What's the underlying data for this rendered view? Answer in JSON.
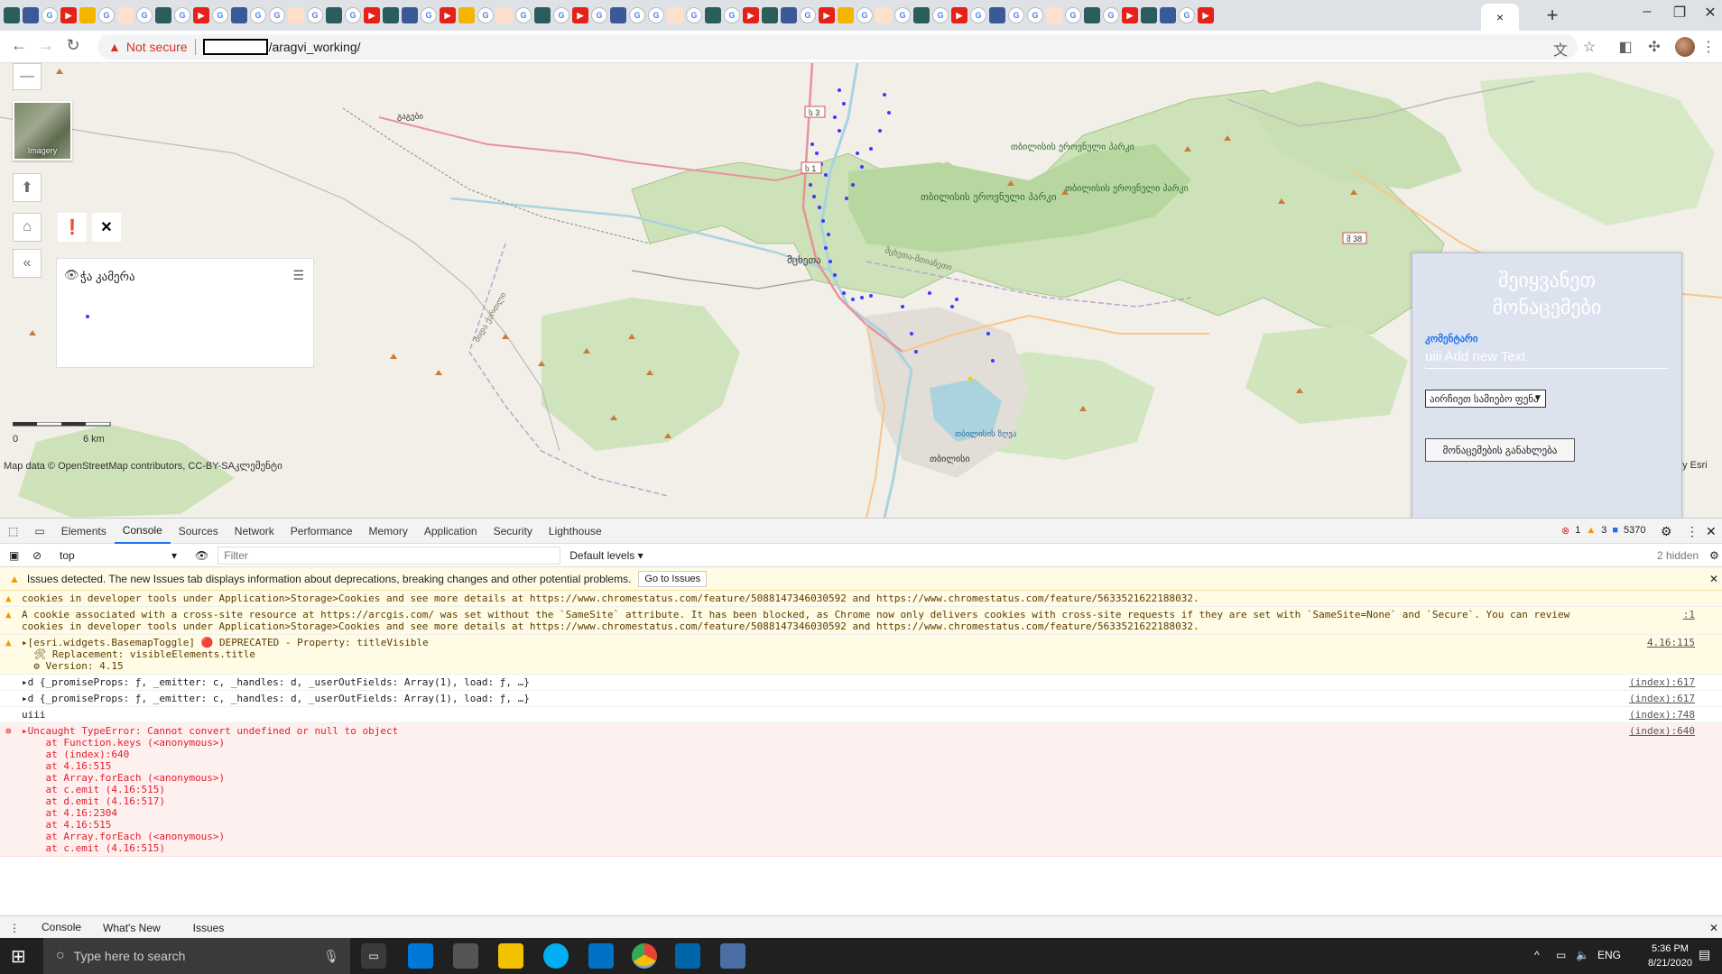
{
  "browser": {
    "tab_count_favicons": 64,
    "active_tab_close": "×",
    "new_tab": "+",
    "window_controls": [
      "–",
      "❐",
      "✕"
    ]
  },
  "address_bar": {
    "security_label": "Not secure",
    "url_path": "/aragvi_working/"
  },
  "map": {
    "basemap_label": "Imagery",
    "zoom_out": "—",
    "legend_title": "ჭა კამერა",
    "scale_zero": "0",
    "scale_km": "6 km",
    "attribution": "Map data © OpenStreetMap contributors, CC-BY-SAკლემენტი",
    "attribution_esri": "by Esri",
    "places": [
      {
        "name": "მცხეთა",
        "kind": "town"
      },
      {
        "name": "თბილისის ეროვნული პარკი",
        "kind": "park"
      },
      {
        "name": "თბილისის ეროვნული პარკი",
        "kind": "park"
      },
      {
        "name": "თბილისის ეროვნული პარკი",
        "kind": "park"
      },
      {
        "name": "თბილისის ზღვა",
        "kind": "water"
      },
      {
        "name": "თბილისი",
        "kind": "city"
      },
      {
        "name": "მცხეთა-მთიანეთი",
        "kind": "region"
      },
      {
        "name": "შიდა ქართლი",
        "kind": "region"
      },
      {
        "name": "გაგები",
        "kind": "town"
      }
    ],
    "road_shields": [
      "ს 3",
      "ს 1",
      "შ 38"
    ]
  },
  "form": {
    "title_line1": "შეიყვანეთ",
    "title_line2": "მონაცემები",
    "field_label": "კომენტარი",
    "field_value": "uiii Add new Text",
    "select_value": "აირჩიეთ სამიებო ფენა",
    "submit_label": "მონაცემების განახლება"
  },
  "devtools": {
    "tabs": [
      "Elements",
      "Console",
      "Sources",
      "Network",
      "Performance",
      "Memory",
      "Application",
      "Security",
      "Lighthouse"
    ],
    "active_tab": "Console",
    "error_count": "1",
    "warning_count": "3",
    "info_count": "5370",
    "context": "top",
    "filter_placeholder": "Filter",
    "levels": "Default levels ▾",
    "hidden": "2 hidden",
    "issues_text": "Issues detected. The new Issues tab displays information about deprecations, breaking changes and other potential problems.",
    "issues_button": "Go to Issues",
    "messages": [
      {
        "type": "warn",
        "text": "cookies in developer tools under Application>Storage>Cookies and see more details at https://www.chromestatus.com/feature/5088147346030592 and https://www.chromestatus.com/feature/5633521622188032.",
        "source": ""
      },
      {
        "type": "warn",
        "text": "A cookie associated with a cross-site resource at https://arcgis.com/ was set without the `SameSite` attribute. It has been blocked, as Chrome now only delivers cookies with cross-site requests if they are set with `SameSite=None` and `Secure`. You can review cookies in developer tools under Application>Storage>Cookies and see more details at https://www.chromestatus.com/feature/5088147346030592 and https://www.chromestatus.com/feature/5633521622188032.",
        "source": ":1"
      },
      {
        "type": "warn",
        "text": "▸[esri.widgets.BasemapToggle] 🔴 DEPRECATED - Property: titleVisible\n  🛠 Replacement: visibleElements.title\n  ⚙ Version: 4.15",
        "source": "4.16:115"
      },
      {
        "type": "log",
        "text": "▸d {_promiseProps: ƒ, _emitter: c, _handles: d, _userOutFields: Array(1), load: ƒ, …}",
        "source": "(index):617"
      },
      {
        "type": "log",
        "text": "▸d {_promiseProps: ƒ, _emitter: c, _handles: d, _userOutFields: Array(1), load: ƒ, …}",
        "source": "(index):617"
      },
      {
        "type": "log",
        "text": "uiii",
        "source": "(index):748"
      },
      {
        "type": "err",
        "text": "▸Uncaught TypeError: Cannot convert undefined or null to object\n    at Function.keys (<anonymous>)\n    at (index):640\n    at 4.16:515\n    at Array.forEach (<anonymous>)\n    at c.emit (4.16:515)\n    at d.emit (4.16:517)\n    at 4.16:2304\n    at 4.16:515\n    at Array.forEach (<anonymous>)\n    at c.emit (4.16:515)",
        "source": "(index):640"
      }
    ],
    "drawer_tabs": [
      "Console",
      "What's New",
      "Issues"
    ]
  },
  "taskbar": {
    "search_placeholder": "Type here to search",
    "language": "ENG",
    "time": "5:36 PM",
    "date": "8/21/2020"
  }
}
